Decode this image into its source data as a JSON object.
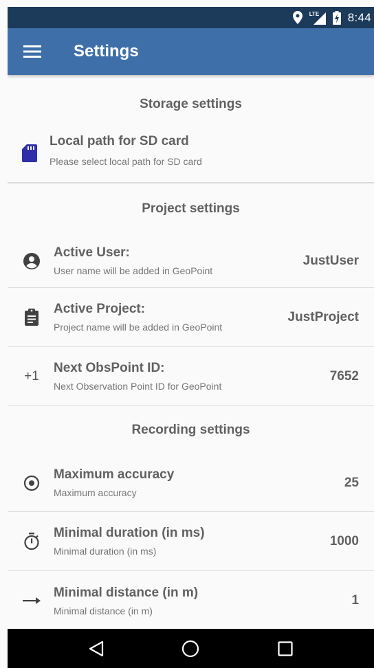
{
  "status_bar": {
    "network": "LTE",
    "time": "8:44"
  },
  "app_bar": {
    "title": "Settings"
  },
  "sections": {
    "storage": {
      "header": "Storage settings",
      "items": [
        {
          "title": "Local path for SD card",
          "summary": "Please select local path for SD card",
          "icon": "sd-card-icon"
        }
      ]
    },
    "project": {
      "header": "Project settings",
      "items": [
        {
          "title": "Active User:",
          "summary": "User name will be added in GeoPoint",
          "value": "JustUser",
          "icon": "account-circle-icon"
        },
        {
          "title": "Active Project:",
          "summary": "Project name will be added in GeoPoint",
          "value": "JustProject",
          "icon": "clipboard-icon"
        },
        {
          "title": "Next ObsPoint ID:",
          "summary": "Next Observation Point ID for GeoPoint",
          "value": "7652",
          "icon_text": "+1"
        }
      ]
    },
    "recording": {
      "header": "Recording settings",
      "items": [
        {
          "title": "Maximum accuracy",
          "summary": "Maximum accuracy",
          "value": "25",
          "icon": "target-icon"
        },
        {
          "title": "Minimal duration (in ms)",
          "summary": "Minimal duration (in ms)",
          "value": "1000",
          "icon": "timer-icon"
        },
        {
          "title": "Minimal distance (in m)",
          "summary": "Minimal distance (in m)",
          "value": "1",
          "icon": "arrow-right-icon"
        }
      ]
    }
  },
  "colors": {
    "status_bar": "#1c3a5a",
    "app_bar": "#3e6fa8",
    "sd_icon": "#2f2fa8",
    "text_primary": "#616161",
    "text_secondary": "#757575",
    "nav_bar": "#000000"
  }
}
